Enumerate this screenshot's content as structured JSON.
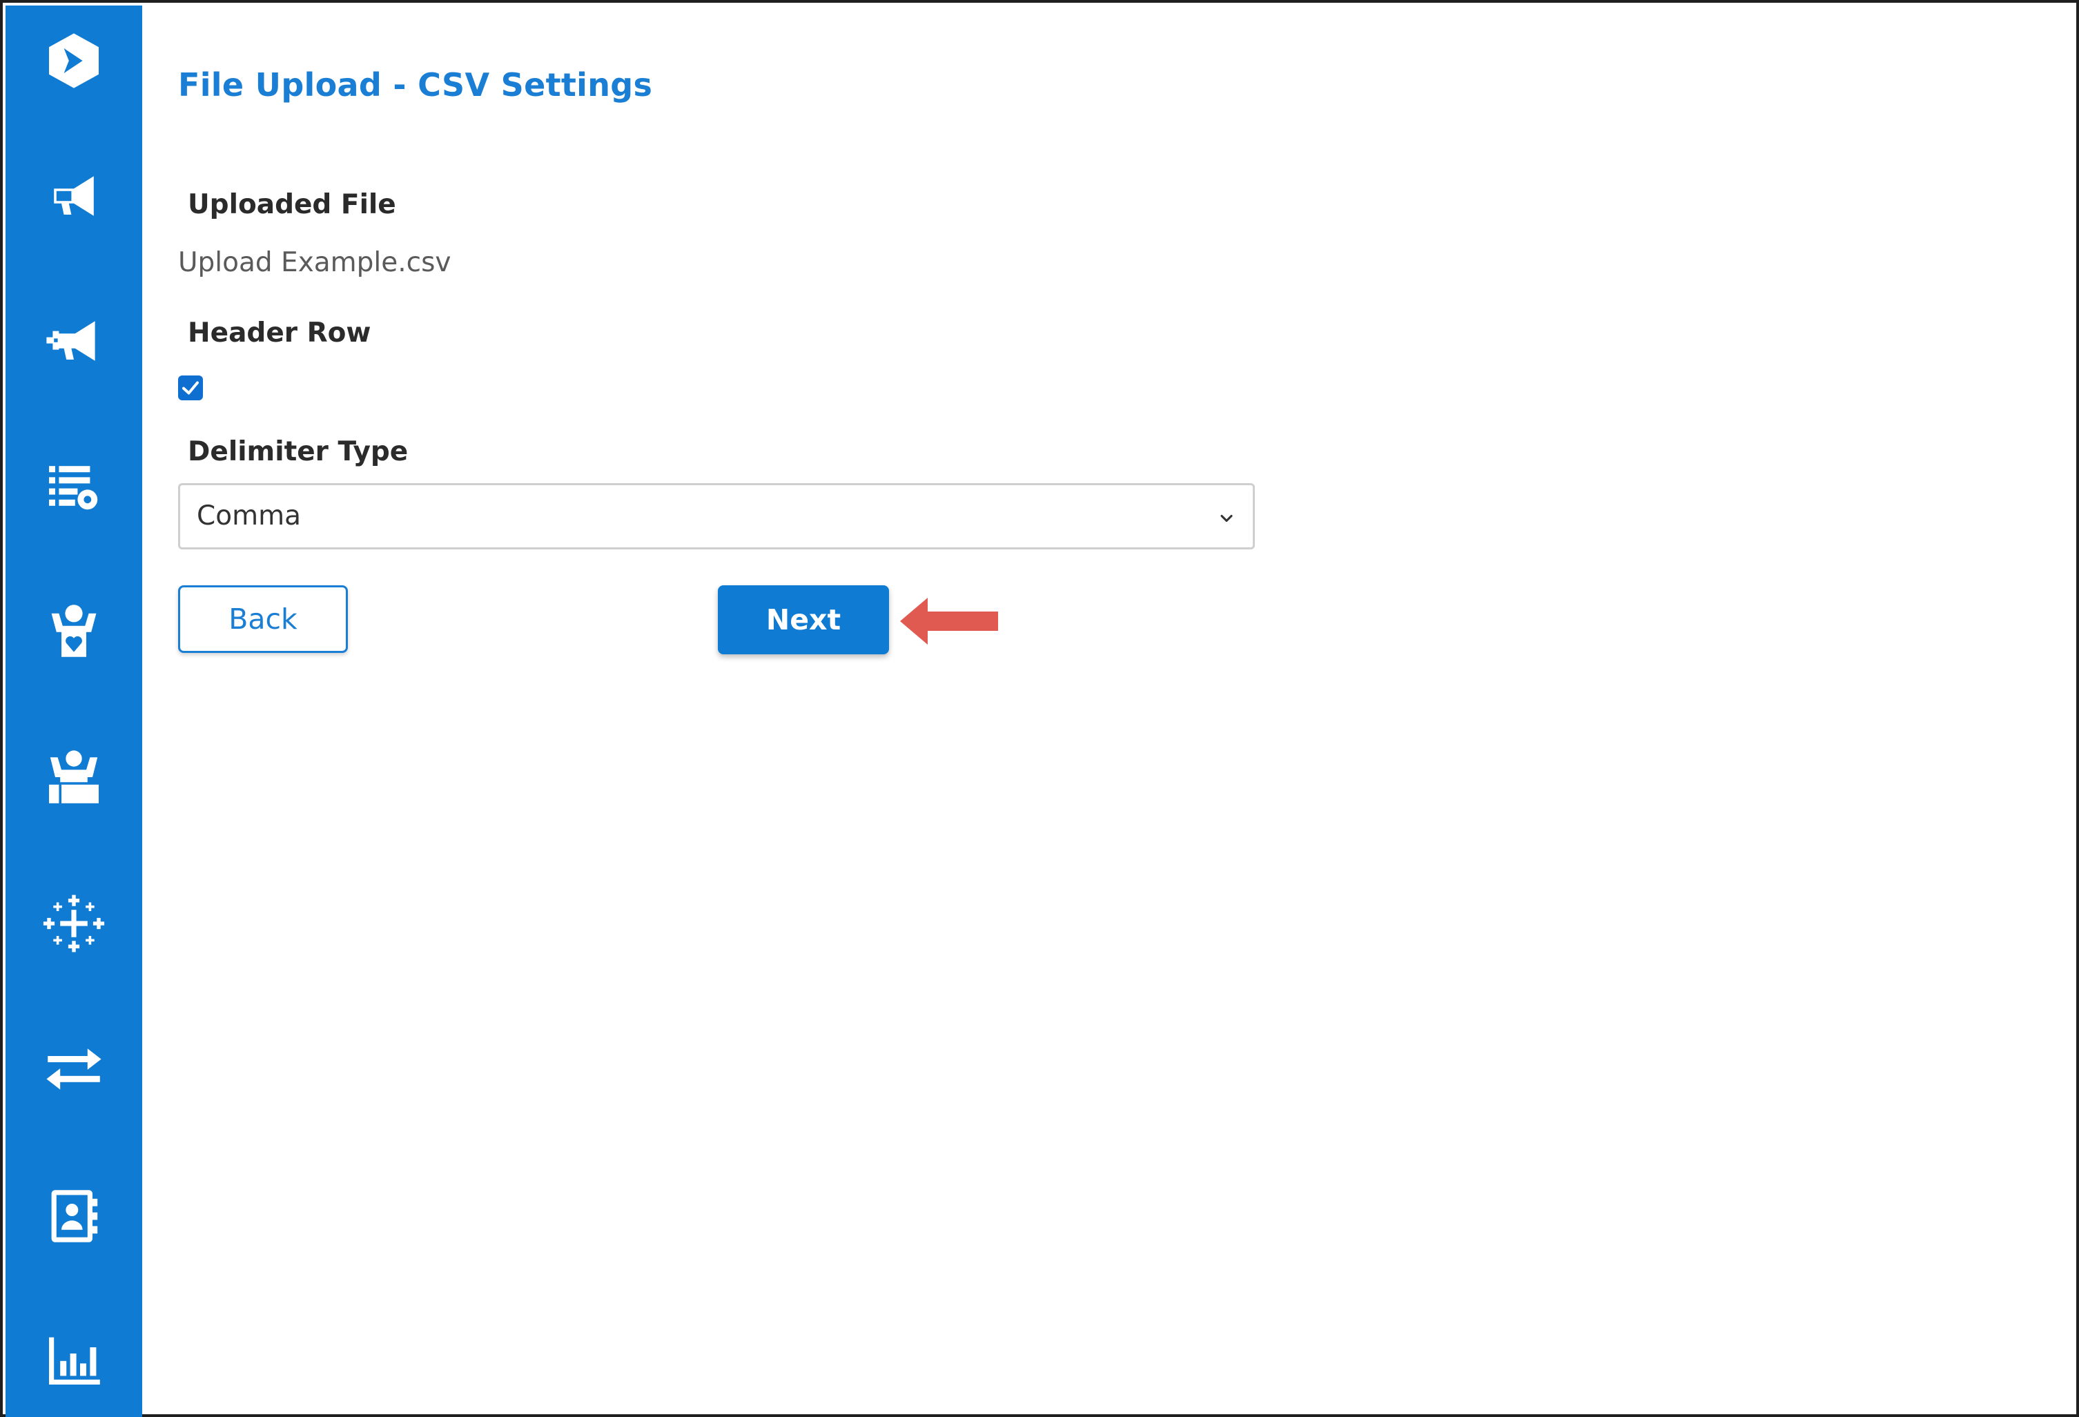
{
  "sidebar": {
    "background": "#0f7bd2",
    "items": [
      {
        "icon": "logo-icon"
      },
      {
        "icon": "megaphone-icon"
      },
      {
        "icon": "megaphone-add-icon"
      },
      {
        "icon": "list-settings-icon"
      },
      {
        "icon": "person-heart-icon"
      },
      {
        "icon": "person-presenting-icon"
      },
      {
        "icon": "sparkle-grid-icon"
      },
      {
        "icon": "transfer-arrows-icon"
      },
      {
        "icon": "contact-book-icon"
      },
      {
        "icon": "bar-chart-icon"
      }
    ]
  },
  "page": {
    "title": "File Upload - CSV Settings",
    "accent_color": "#1a7ed4"
  },
  "uploaded_file": {
    "label": "Uploaded File",
    "value": "Upload Example.csv"
  },
  "header_row": {
    "label": "Header Row",
    "checked": true
  },
  "delimiter": {
    "label": "Delimiter Type",
    "selected": "Comma"
  },
  "actions": {
    "back_label": "Back",
    "next_label": "Next"
  },
  "annotation": {
    "arrow_color": "#e05a52",
    "points_to": "next-button"
  }
}
